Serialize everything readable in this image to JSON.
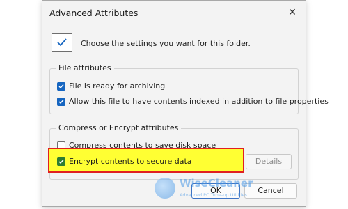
{
  "dialog": {
    "title": "Advanced Attributes",
    "intro": "Choose the settings you want for this folder."
  },
  "file_attributes": {
    "legend": "File attributes",
    "items": [
      {
        "label": "File is ready for archiving",
        "checked": true
      },
      {
        "label": "Allow this file to have contents indexed in addition to file properties",
        "checked": true
      }
    ]
  },
  "compress_encrypt": {
    "legend": "Compress or Encrypt attributes",
    "items": [
      {
        "label": "Compress contents to save disk space",
        "checked": false
      },
      {
        "label": "Encrypt contents to secure data",
        "checked": true
      }
    ],
    "details_label": "Details"
  },
  "buttons": {
    "ok": "OK",
    "cancel": "Cancel"
  },
  "watermark": {
    "name": "WiseCleaner",
    "tagline": "Advanced PC Tune-up Utilities"
  },
  "colors": {
    "highlight": "#ffff33",
    "highlight_border": "#e02020",
    "checkbox_accent": "#1565c0"
  }
}
